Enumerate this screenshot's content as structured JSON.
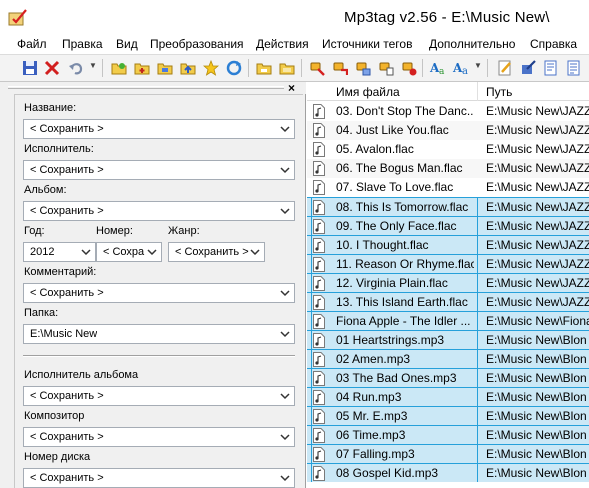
{
  "window": {
    "title": "Mp3tag v2.56  -  E:\\Music New\\"
  },
  "menu": [
    {
      "label": "Файл",
      "name": "menu-file"
    },
    {
      "label": "Правка",
      "name": "menu-edit"
    },
    {
      "label": "Вид",
      "name": "menu-view"
    },
    {
      "label": "Преобразования",
      "name": "menu-convert"
    },
    {
      "label": "Действия",
      "name": "menu-actions"
    },
    {
      "label": "Источники тегов",
      "name": "menu-tag-sources"
    },
    {
      "label": "Дополнительно",
      "name": "menu-extra"
    },
    {
      "label": "Справка",
      "name": "menu-help"
    }
  ],
  "toolbar": {
    "icons": [
      "save-icon",
      "remove-tag-icon",
      "undo-icon",
      "open-folder-icon",
      "add-folder-icon",
      "favorites-icon",
      "refresh-icon",
      "playlist-icon",
      "export-icon",
      "tag-to-filename-icon",
      "filename-to-tag-icon",
      "text-file-icon",
      "case-conversion-icon",
      "actions-icon",
      "edit-icon",
      "web-source-icon",
      "options-icon"
    ]
  },
  "tag_panel": {
    "fields": {
      "title": {
        "label": "Название:",
        "value": "< Сохранить >"
      },
      "artist": {
        "label": "Исполнитель:",
        "value": "< Сохранить >"
      },
      "album": {
        "label": "Альбом:",
        "value": "< Сохранить >"
      },
      "year": {
        "label": "Год:",
        "value": "2012"
      },
      "track": {
        "label": "Номер:",
        "value": "< Сохра"
      },
      "genre": {
        "label": "Жанр:",
        "value": "< Сохранить >"
      },
      "comment": {
        "label": "Комментарий:",
        "value": "< Сохранить >"
      },
      "folder": {
        "label": "Папка:",
        "value": "E:\\Music New"
      },
      "album_artist": {
        "label": "Исполнитель альбома",
        "value": "< Сохранить >"
      },
      "composer": {
        "label": "Композитор",
        "value": "< Сохранить >"
      },
      "disc": {
        "label": "Номер диска",
        "value": "< Сохранить >"
      }
    }
  },
  "file_list": {
    "columns": [
      "Имя файла",
      "Путь"
    ],
    "rows": [
      {
        "name": "03. Don't Stop The Danc...",
        "path": "E:\\Music New\\JAZZ",
        "selected": false
      },
      {
        "name": "04. Just Like You.flac",
        "path": "E:\\Music New\\JAZZ",
        "selected": false
      },
      {
        "name": "05. Avalon.flac",
        "path": "E:\\Music New\\JAZZ",
        "selected": false
      },
      {
        "name": "06. The Bogus Man.flac",
        "path": "E:\\Music New\\JAZZ",
        "selected": false
      },
      {
        "name": "07. Slave To Love.flac",
        "path": "E:\\Music New\\JAZZ",
        "selected": false
      },
      {
        "name": "08. This Is Tomorrow.flac",
        "path": "E:\\Music New\\JAZZ",
        "selected": true
      },
      {
        "name": "09. The Only Face.flac",
        "path": "E:\\Music New\\JAZZ",
        "selected": true
      },
      {
        "name": "10. I Thought.flac",
        "path": "E:\\Music New\\JAZZ",
        "selected": true
      },
      {
        "name": "11. Reason Or Rhyme.flac",
        "path": "E:\\Music New\\JAZZ",
        "selected": true
      },
      {
        "name": "12. Virginia Plain.flac",
        "path": "E:\\Music New\\JAZZ",
        "selected": true
      },
      {
        "name": "13. This Island Earth.flac",
        "path": "E:\\Music New\\JAZZ",
        "selected": true
      },
      {
        "name": "Fiona Apple - The Idler ...",
        "path": "E:\\Music New\\Fiona",
        "selected": true
      },
      {
        "name": "01 Heartstrings.mp3",
        "path": "E:\\Music New\\Blon",
        "selected": true
      },
      {
        "name": "02 Amen.mp3",
        "path": "E:\\Music New\\Blon",
        "selected": true
      },
      {
        "name": "03 The Bad Ones.mp3",
        "path": "E:\\Music New\\Blon",
        "selected": true
      },
      {
        "name": "04 Run.mp3",
        "path": "E:\\Music New\\Blon",
        "selected": true
      },
      {
        "name": "05 Mr. E.mp3",
        "path": "E:\\Music New\\Blon",
        "selected": true
      },
      {
        "name": "06 Time.mp3",
        "path": "E:\\Music New\\Blon",
        "selected": true
      },
      {
        "name": "07 Falling.mp3",
        "path": "E:\\Music New\\Blon",
        "selected": true
      },
      {
        "name": "08 Gospel Kid.mp3",
        "path": "E:\\Music New\\Blon",
        "selected": true
      }
    ]
  }
}
